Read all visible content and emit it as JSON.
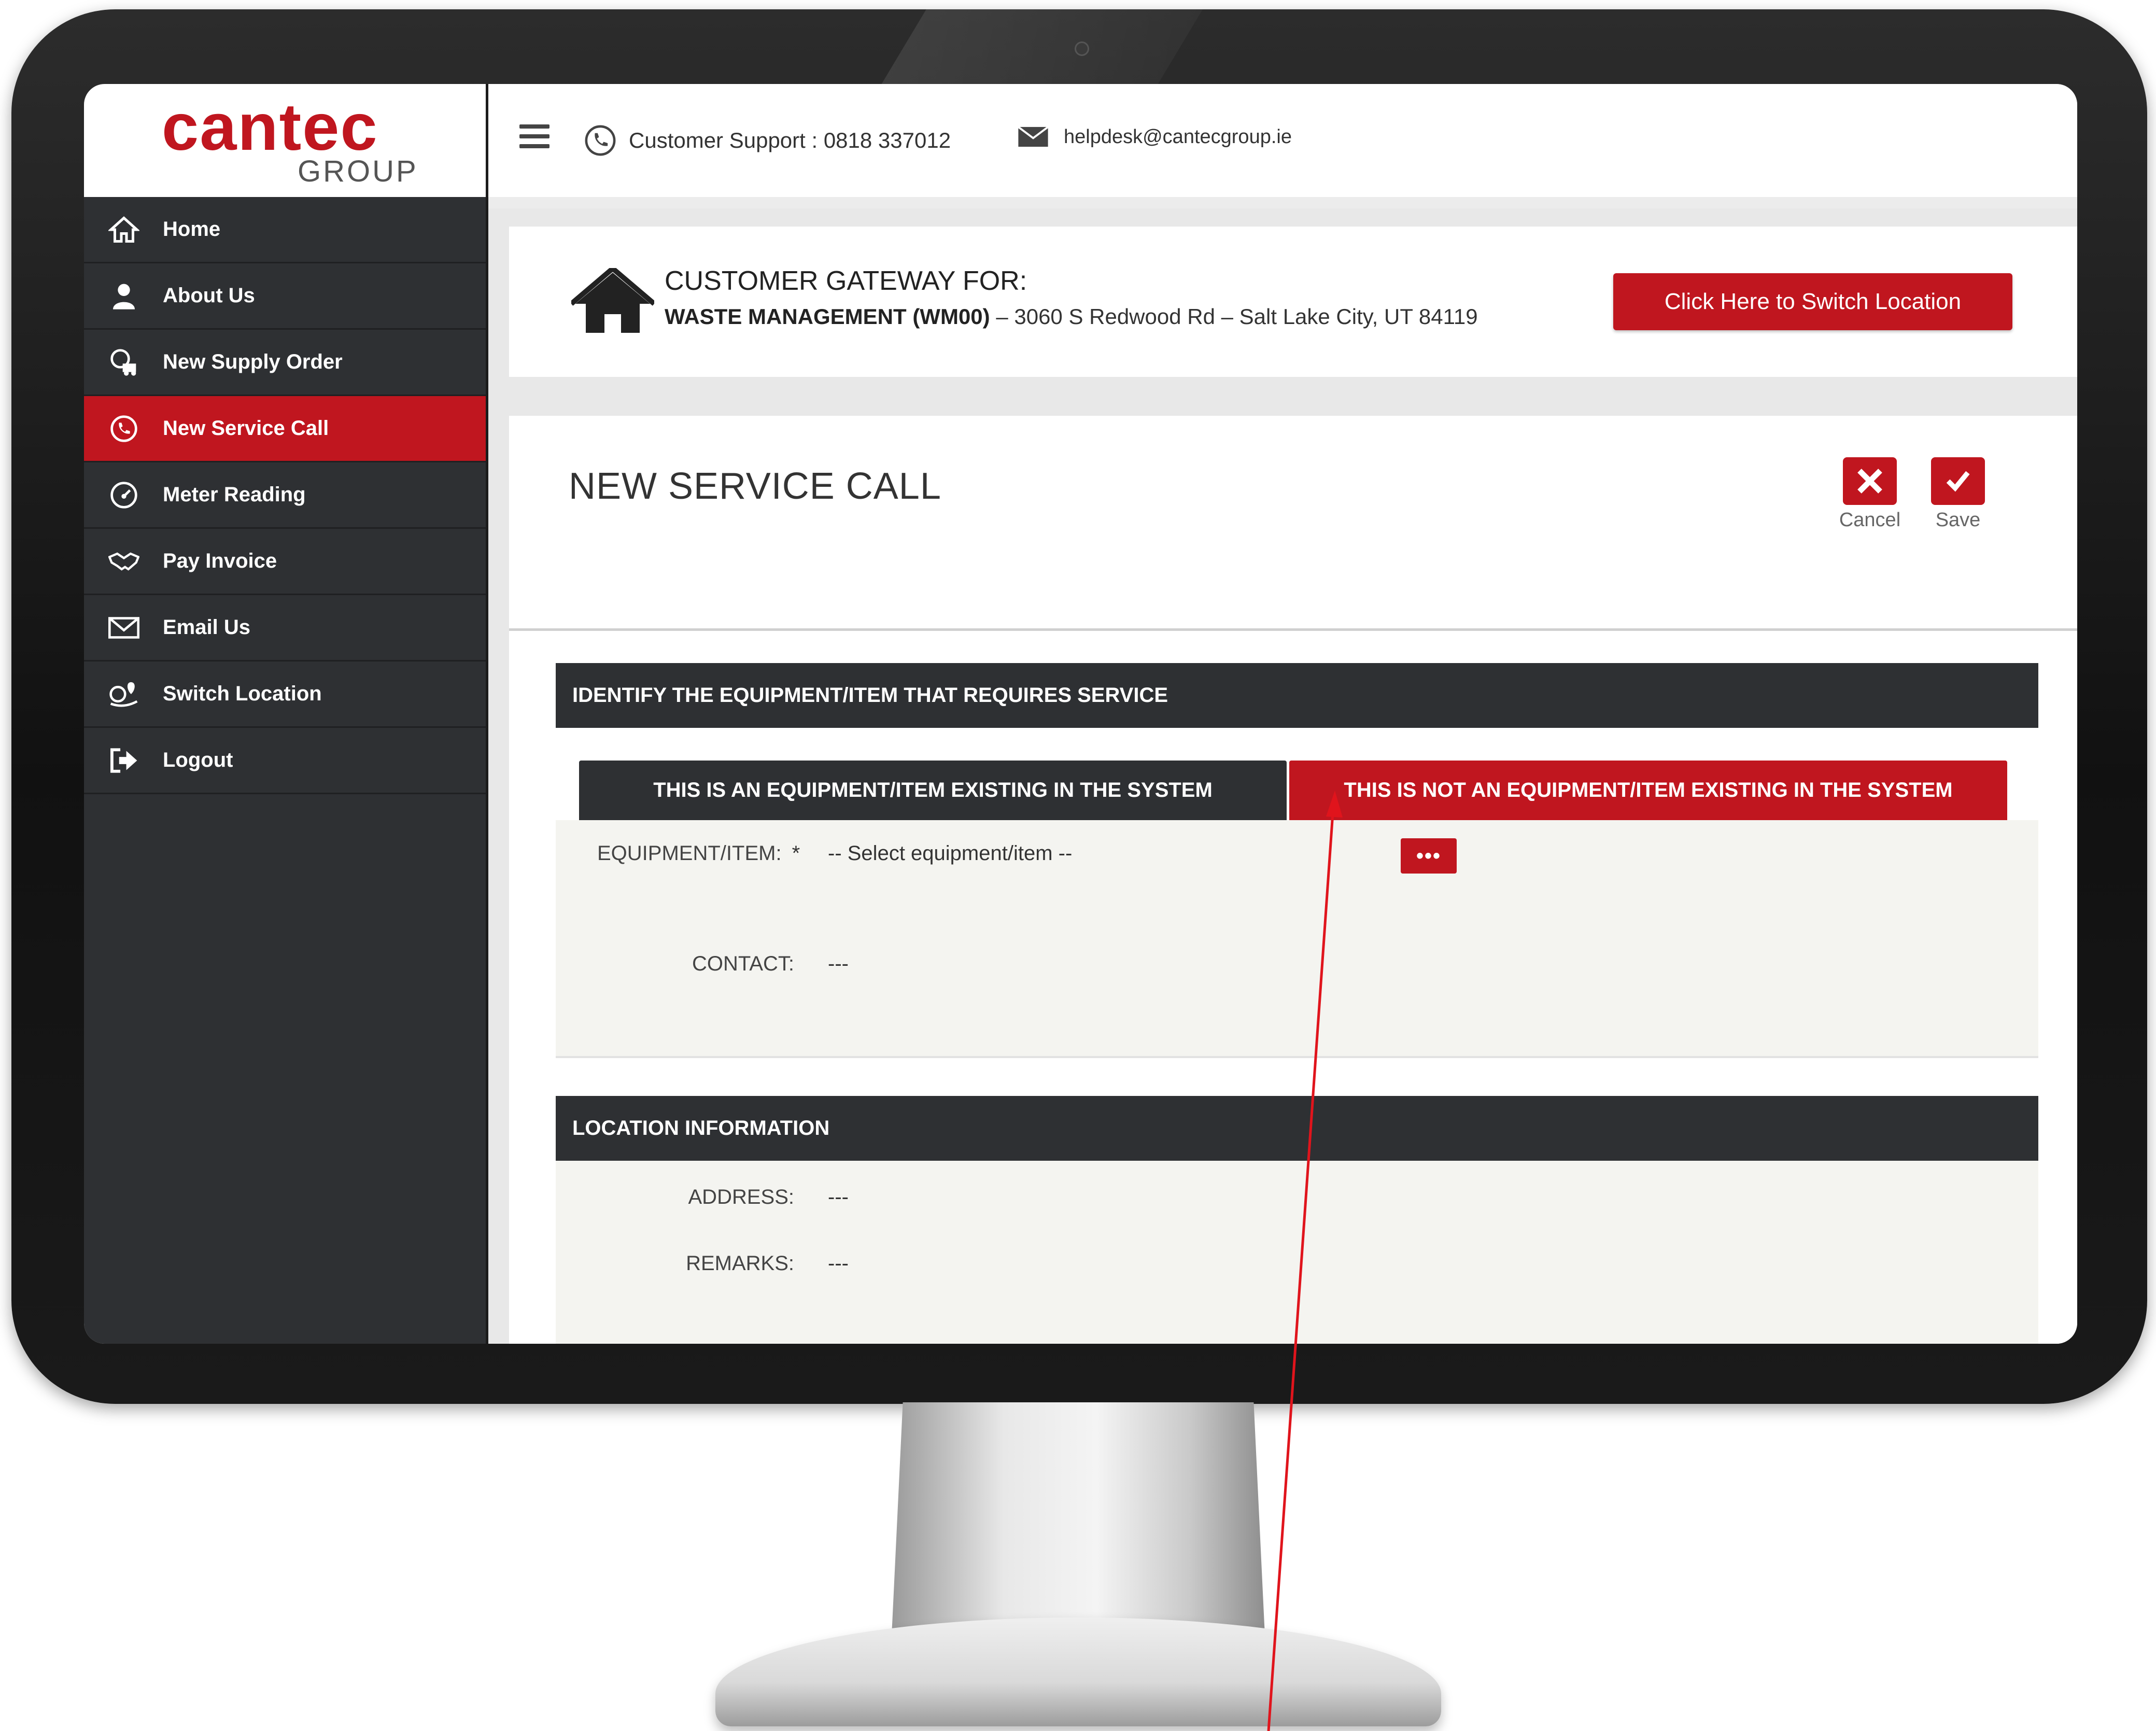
{
  "brand": {
    "name": "cantec",
    "subname": "GROUP"
  },
  "sidebar": {
    "items": [
      {
        "label": "Home",
        "icon": "home-icon",
        "active": false
      },
      {
        "label": "About Us",
        "icon": "user-icon",
        "active": false
      },
      {
        "label": "New Supply Order",
        "icon": "supply-order-icon",
        "active": false
      },
      {
        "label": "New Service Call",
        "icon": "service-call-icon",
        "active": true
      },
      {
        "label": "Meter Reading",
        "icon": "meter-icon",
        "active": false
      },
      {
        "label": "Pay Invoice",
        "icon": "handshake-icon",
        "active": false
      },
      {
        "label": "Email Us",
        "icon": "envelope-icon",
        "active": false
      },
      {
        "label": "Switch Location",
        "icon": "switch-location-icon",
        "active": false
      },
      {
        "label": "Logout",
        "icon": "logout-icon",
        "active": false
      }
    ]
  },
  "topbar": {
    "support_text": "Customer Support : 0818 337012",
    "email": "helpdesk@cantecgroup.ie"
  },
  "gateway": {
    "title": "CUSTOMER GATEWAY FOR:",
    "company": "WASTE MANAGEMENT (WM00)",
    "address": " – 3060 S Redwood Rd – Salt Lake City, UT 84119",
    "switch_button": "Click Here to Switch Location"
  },
  "form": {
    "title": "NEW SERVICE CALL",
    "cancel_label": "Cancel",
    "save_label": "Save",
    "section1_title": "IDENTIFY THE EQUIPMENT/ITEM THAT REQUIRES SERVICE",
    "tab_existing": "THIS IS AN EQUIPMENT/ITEM EXISTING IN THE SYSTEM",
    "tab_not_existing": "THIS IS NOT AN EQUIPMENT/ITEM EXISTING IN THE SYSTEM",
    "equipment_label": "EQUIPMENT/ITEM:",
    "required_mark": "*",
    "equipment_value": "-- Select equipment/item --",
    "dots_button": "•••",
    "contact_label": "CONTACT:",
    "contact_value": "---",
    "section2_title": "LOCATION INFORMATION",
    "address_label": "ADDRESS:",
    "address_value": "---",
    "remarks_label": "REMARKS:",
    "remarks_value": "---"
  },
  "colors": {
    "accent": "#c0161f",
    "sidebar_bg": "#2e3033",
    "annotation_line": "#e0141c"
  }
}
